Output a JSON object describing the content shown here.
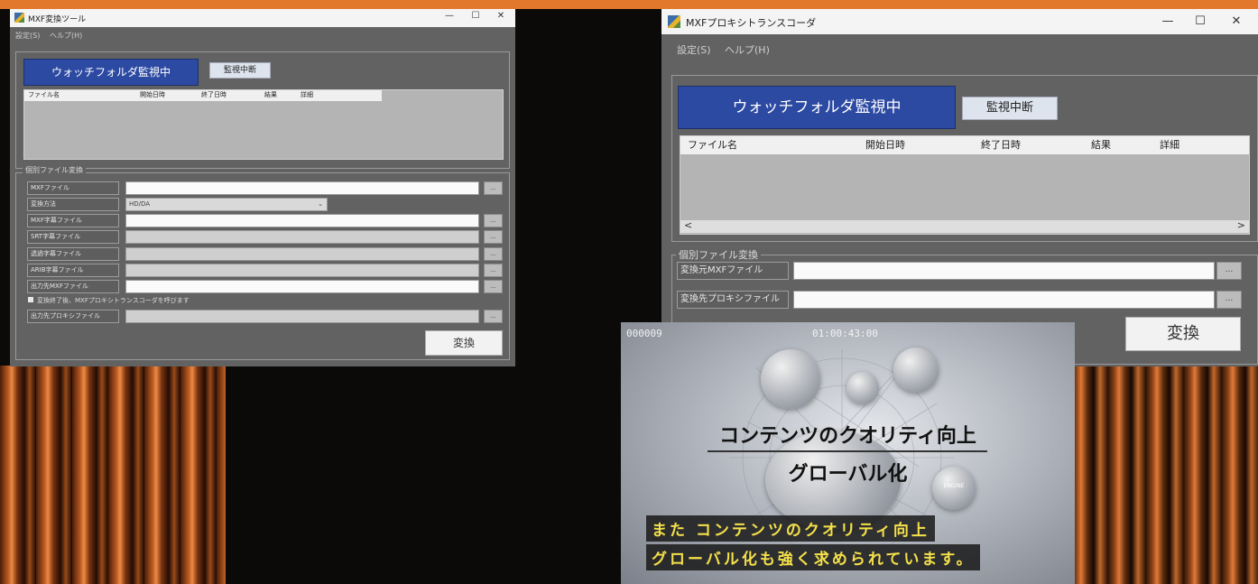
{
  "windowA": {
    "title": "MXF変換ツール",
    "menu": [
      "設定(S)",
      "ヘルプ(H)"
    ],
    "controls": {
      "minimize": "—",
      "maximize": "☐",
      "close": "✕"
    },
    "watch_status": "ウォッチフォルダ監視中",
    "stop_button": "監視中断",
    "columns": [
      "ファイル名",
      "開始日時",
      "終了日時",
      "結果",
      "詳細"
    ],
    "group_label": "個別ファイル変換",
    "fields": [
      {
        "label": "MXFファイル",
        "kind": "input"
      },
      {
        "label": "変換方法",
        "kind": "select",
        "value": "HD/DA"
      },
      {
        "label": "MXF字幕ファイル",
        "kind": "input"
      },
      {
        "label": "SRT字幕ファイル",
        "kind": "input"
      },
      {
        "label": "透過字幕ファイル",
        "kind": "input"
      },
      {
        "label": "ARIB字幕ファイル",
        "kind": "input"
      },
      {
        "label": "出力先MXFファイル",
        "kind": "input"
      }
    ],
    "checkbox_label": "変換終了後、MXFプロキシトランスコーダを呼びます",
    "proxy_label": "出力先プロキシファイル",
    "browse_label": "...",
    "convert_button": "変換"
  },
  "windowB": {
    "title": "MXFプロキシトランスコーダ",
    "menu": [
      "設定(S)",
      "ヘルプ(H)"
    ],
    "controls": {
      "minimize": "—",
      "maximize": "☐",
      "close": "✕"
    },
    "watch_status": "ウォッチフォルダ監視中",
    "stop_button": "監視中断",
    "columns": [
      "ファイル名",
      "開始日時",
      "終了日時",
      "結果",
      "詳細"
    ],
    "scroll_left": "<",
    "scroll_right": ">",
    "group_label": "個別ファイル変換",
    "fields": [
      {
        "label": "変換元MXFファイル",
        "browse": "..."
      },
      {
        "label": "変換先プロキシファイル",
        "browse": "..."
      }
    ],
    "convert_button": "変換"
  },
  "video": {
    "frame": "000009",
    "timecode": "01:00:43:00",
    "caption_lines": [
      "コンテンツのクオリティ向上",
      "グローバル化"
    ],
    "subtitle_lines": [
      "また コンテンツのクオリティ向上",
      "グローバル化も強く求められています。"
    ],
    "icon_label": "ENGINE"
  },
  "colors": {
    "accent": "#e2782c",
    "watch_button": "#2d4aa2",
    "window_bg": "#626262",
    "subtitle": "#f4e04a"
  }
}
